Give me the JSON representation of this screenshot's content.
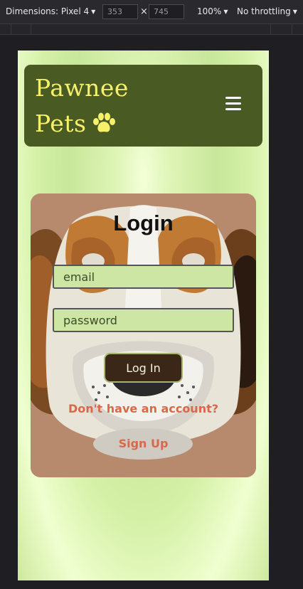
{
  "devtools": {
    "dimensions_label": "Dimensions: Pixel 4",
    "width": "353",
    "height": "745",
    "times": "×",
    "zoom": "100%",
    "throttling": "No throttling"
  },
  "header": {
    "brand_line1": "Pawnee",
    "brand_line2": "Pets",
    "brand_icon": "paw-icon",
    "menu_icon": "hamburger-menu-icon",
    "brand_color": "#f6f06a",
    "bg_color": "#4a5a23"
  },
  "login": {
    "title": "Login",
    "email_placeholder": "email",
    "password_placeholder": "password",
    "submit_label": "Log In",
    "no_account_text": "Don't have an account?",
    "signup_label": "Sign Up",
    "link_color": "#d9684a"
  }
}
